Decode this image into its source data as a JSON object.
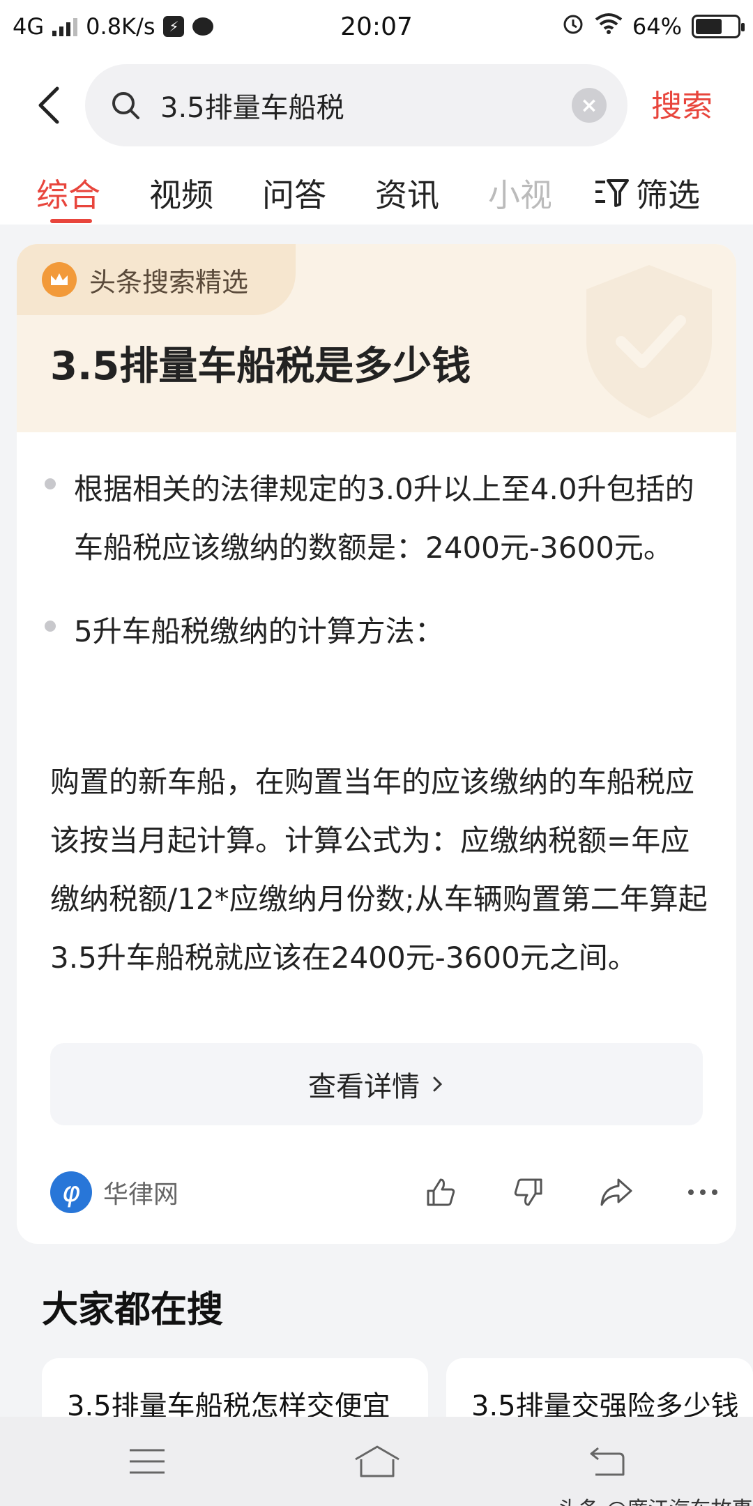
{
  "status_bar": {
    "network": "4G",
    "speed": "0.8K/s",
    "time": "20:07",
    "battery_percent": "64%",
    "battery_level": 0.64
  },
  "header": {
    "search_query": "3.5排量车船税",
    "search_button": "搜索",
    "tabs": [
      "综合",
      "视频",
      "问答",
      "资讯",
      "小视",
      "筛选"
    ],
    "active_tab": "综合"
  },
  "card": {
    "badge": "头条搜索精选",
    "title": "3.5排量车船税是多少钱",
    "bullets": [
      "根据相关的法律规定的3.0升以上至4.0升包括的车船税应该缴纳的数额是：2400元-3600元。",
      "5升车船税缴纳的计算方法："
    ],
    "paragraph": "购置的新车船，在购置当年的应该缴纳的车船税应该按当月起计算。计算公式为：应缴纳税额=年应缴纳税额/12*应缴纳月份数;从车辆购置第二年算起3.5升车船税就应该在2400元-3600元之间。",
    "detail_button": "查看详情",
    "source": "华律网"
  },
  "related": {
    "title": "大家都在搜",
    "items": [
      "3.5排量车船税怎样交便宜",
      "3.5排量交强险多少钱"
    ]
  },
  "watermark": "头条 @廉江汽车故事",
  "colors": {
    "accent": "#e8453c",
    "badge_bg": "#f6e6cf",
    "source_logo": "#2876d8"
  }
}
